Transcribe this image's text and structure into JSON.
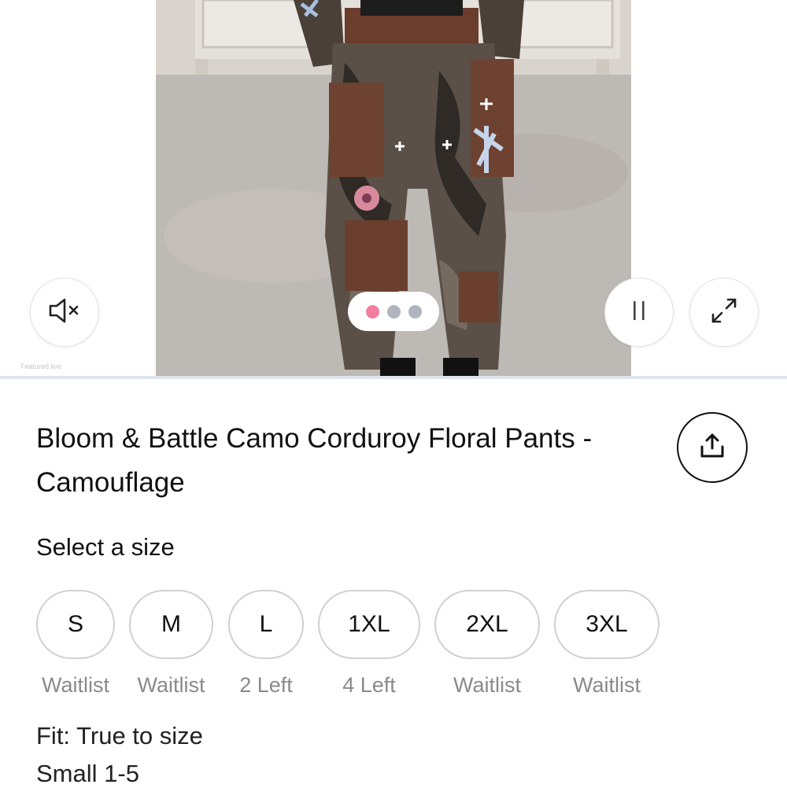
{
  "media": {
    "featured_label": "Featured live",
    "slides": [
      "active",
      "inactive",
      "inactive"
    ],
    "controls": {
      "mute_icon": "speaker-muted-icon",
      "pause_icon": "pause-icon",
      "expand_icon": "expand-arrows-icon"
    }
  },
  "product": {
    "title": "Bloom & Battle Camo Corduroy Floral Pants - Camouflage",
    "share_icon": "share-upload-icon"
  },
  "sizes": {
    "label": "Select a size",
    "options": [
      {
        "size": "S",
        "availability": "Waitlist"
      },
      {
        "size": "M",
        "availability": "Waitlist"
      },
      {
        "size": "L",
        "availability": "2 Left"
      },
      {
        "size": "1XL",
        "availability": "4 Left"
      },
      {
        "size": "2XL",
        "availability": "Waitlist"
      },
      {
        "size": "3XL",
        "availability": "Waitlist"
      }
    ]
  },
  "details": {
    "fit": "Fit: True to size",
    "small": "Small 1-5"
  },
  "colors": {
    "active_dot": "#ef7f9c",
    "inactive_dot": "#b0b4bd",
    "muted_text": "#8a8a8a"
  }
}
